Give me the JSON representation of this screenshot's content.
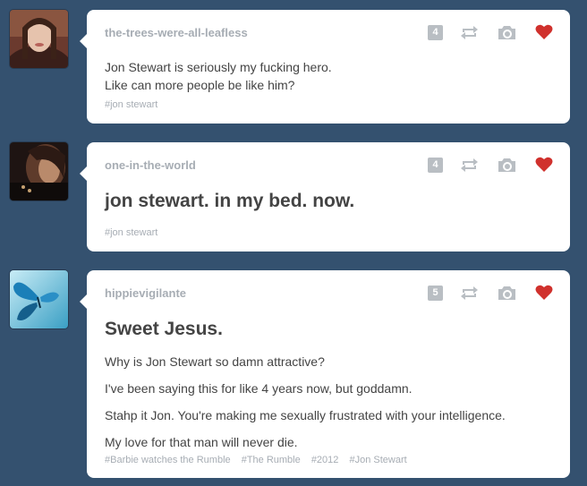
{
  "posts": [
    {
      "blog": "the-trees-were-all-leafless",
      "notes": "4",
      "lines": [
        "Jon Stewart is seriously my fucking hero.",
        "Like can more people be like him?"
      ],
      "tags": [
        "#jon stewart"
      ]
    },
    {
      "blog": "one-in-the-world",
      "notes": "4",
      "heading": "jon stewart. in my bed. now.",
      "tags": [
        "#jon stewart"
      ]
    },
    {
      "blog": "hippievigilante",
      "notes": "5",
      "heading": "Sweet Jesus.",
      "lines": [
        "Why is Jon Stewart so damn attractive?",
        "I've been saying this for like 4 years now, but goddamn.",
        "Stahp it Jon. You're making me sexually frustrated with your intelligence.",
        "My love for that man will never die."
      ],
      "tags": [
        "#Barbie watches the Rumble",
        "#The Rumble",
        "#2012",
        "#Jon Stewart"
      ]
    }
  ],
  "icons": {
    "reblog": "reblog-icon",
    "photo": "camera-icon",
    "like": "heart-icon"
  },
  "colors": {
    "background": "#34516f",
    "like": "#d0312d",
    "muted": "#a7adb4"
  }
}
